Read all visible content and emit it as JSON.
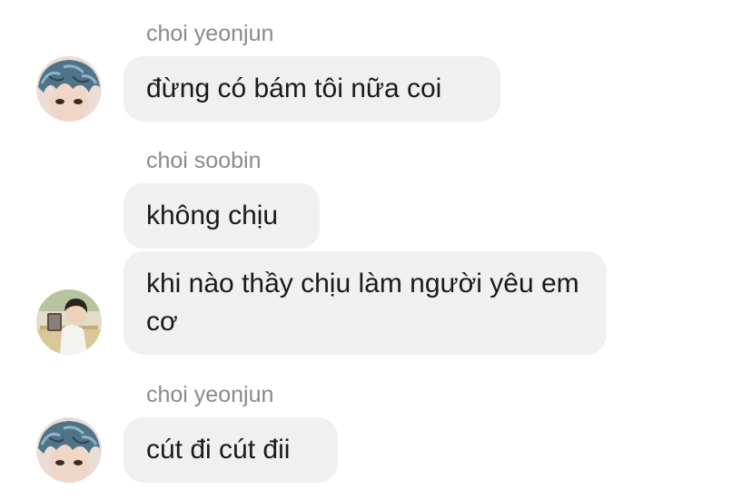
{
  "messages": [
    {
      "sender": "choi yeonjun",
      "text": "đừng có bám tôi nữa coi"
    },
    {
      "sender": "choi soobin",
      "text": "không chịu"
    },
    {
      "text": "khi nào thầy chịu làm người yêu em cơ"
    },
    {
      "sender": "choi yeonjun",
      "text": "cút đi cút đii"
    }
  ],
  "avatars": {
    "yeonjun": "avatar-yeonjun",
    "soobin": "avatar-soobin"
  },
  "colors": {
    "bubble": "#f0f0f0",
    "sender_name": "#8a8a8e",
    "text": "#1a1a1a",
    "background": "#ffffff"
  }
}
